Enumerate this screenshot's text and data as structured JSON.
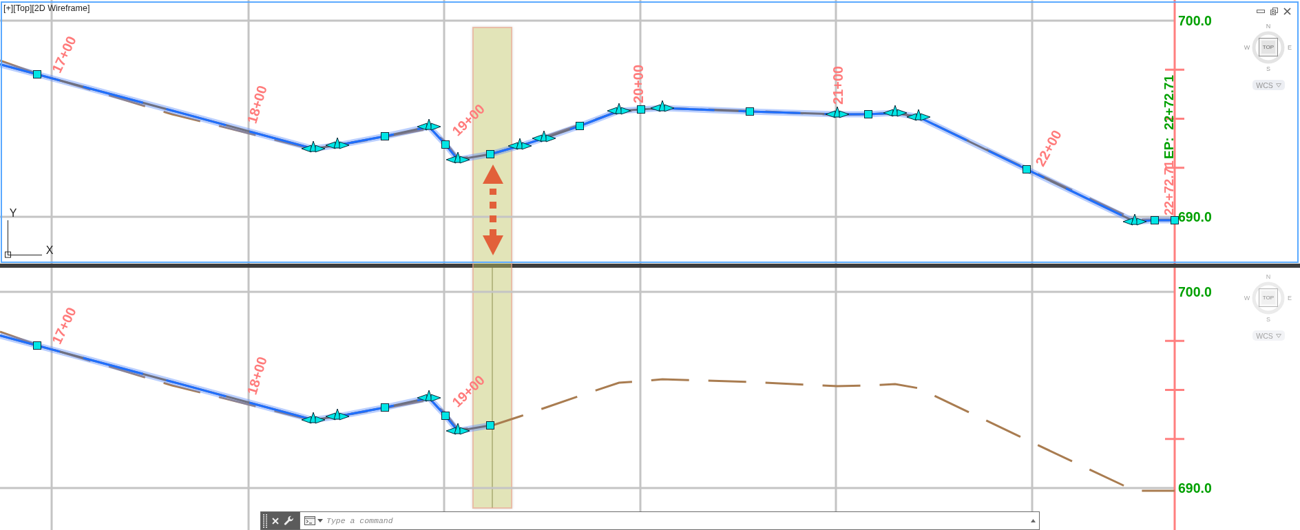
{
  "viewports": [
    {
      "selected": true,
      "menus": [
        "[+]",
        "[Top]",
        "[2D Wireframe]"
      ],
      "ucs_icon": {
        "x_label": "X",
        "y_label": "Y"
      },
      "viewcube": {
        "north": "N",
        "south": "S",
        "west": "W",
        "east": "E",
        "face": "TOP",
        "ucs": "WCS"
      },
      "elevation_labels": [
        "700.0",
        "690.0"
      ],
      "station_labels": [
        "17+00",
        "18+00",
        "19+00",
        "20+00",
        "21+00",
        "22+00"
      ],
      "end_station_label": "22+72.71",
      "end_label": "EP:  22+72.71"
    },
    {
      "selected": false,
      "viewcube": {
        "north": "N",
        "south": "S",
        "west": "W",
        "east": "E",
        "face": "TOP",
        "ucs": "WCS"
      },
      "elevation_labels": [
        "700.0",
        "690.0"
      ],
      "station_labels": [
        "17+00",
        "18+00",
        "19+00"
      ]
    }
  ],
  "command_line": {
    "placeholder": "Type a command"
  }
}
